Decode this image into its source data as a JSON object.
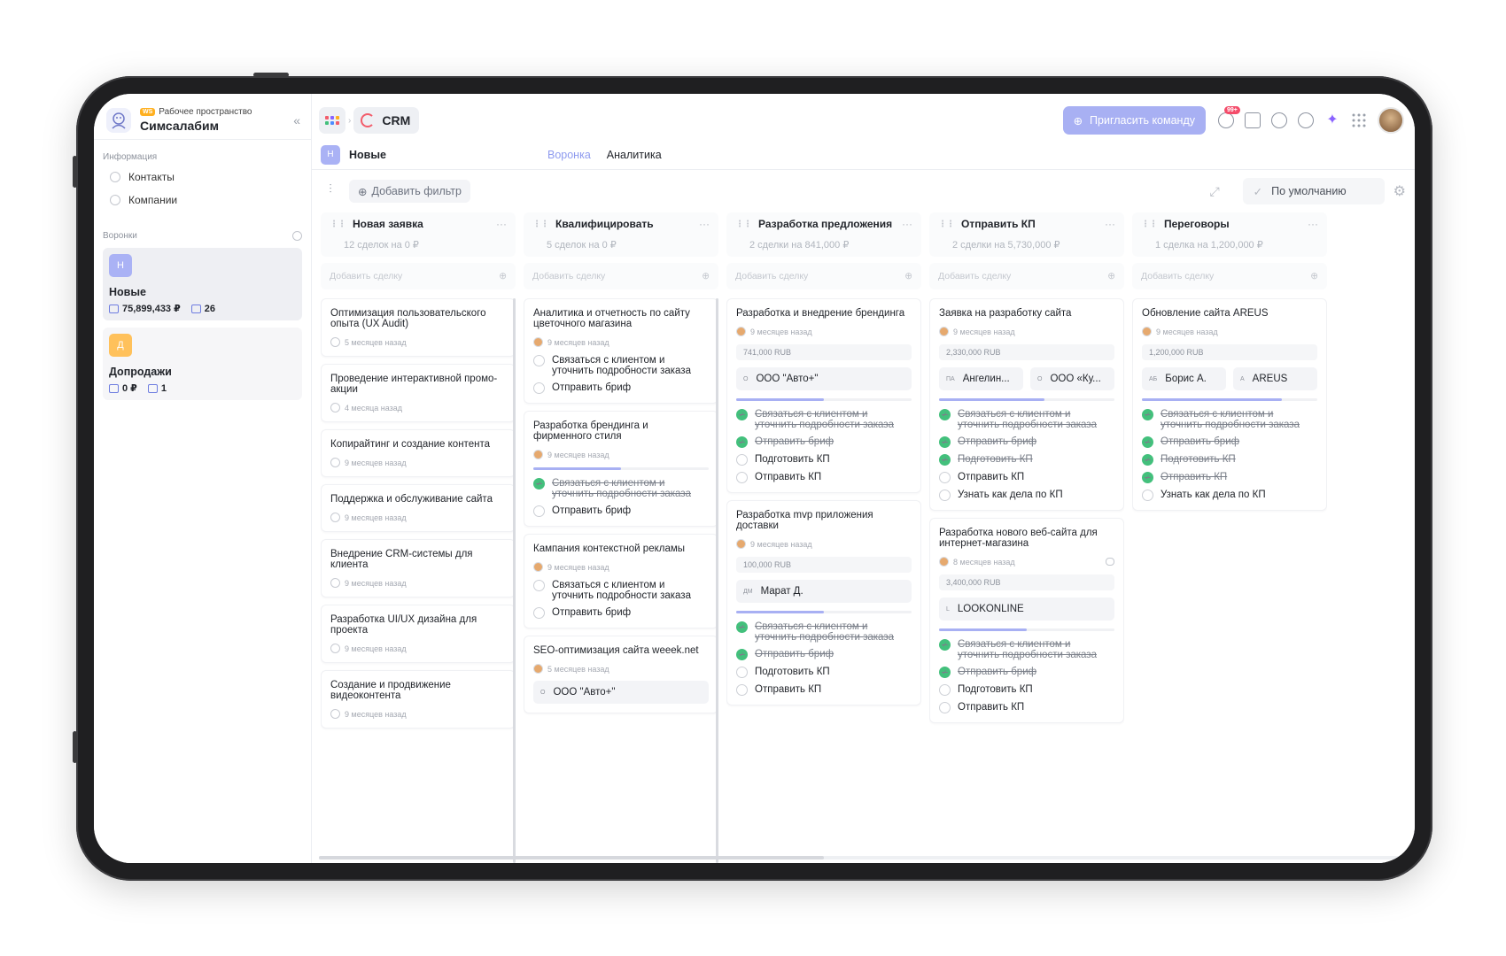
{
  "workspace": {
    "badge": "WS",
    "label": "Рабочее пространство",
    "name": "Симсалабим"
  },
  "sidebar": {
    "info_title": "Информация",
    "info_items": [
      {
        "label": "Контакты"
      },
      {
        "label": "Компании"
      }
    ],
    "funnels_title": "Воронки",
    "funnels": [
      {
        "letter": "Н",
        "name": "Новые",
        "amount": "75,899,433 ₽",
        "count": "26",
        "color": "#aab2f5"
      },
      {
        "letter": "Д",
        "name": "Допродажи",
        "amount": "0 ₽",
        "count": "1",
        "color": "#ffc15b"
      }
    ]
  },
  "topbar": {
    "crm_label": "CRM",
    "invite_label": "Пригласить команду",
    "bell_badge": "99+"
  },
  "subbar": {
    "letter": "Н",
    "title": "Новые",
    "tab_funnel": "Воронка",
    "tab_analytics": "Аналитика"
  },
  "filterbar": {
    "add_filter": "Добавить фильтр",
    "default_view": "По умолчанию"
  },
  "board": {
    "add_deal": "Добавить сделку",
    "columns": [
      {
        "title": "Новая заявка",
        "summary": "12 сделок на 0 ₽",
        "cards": [
          {
            "title": "Оптимизация пользовательского опыта (UX Audit)",
            "time": "5 месяцев назад"
          },
          {
            "title": "Проведение интерактивной промо-акции",
            "time": "4 месяца назад"
          },
          {
            "title": "Копирайтинг и создание контента",
            "time": "9 месяцев назад"
          },
          {
            "title": "Поддержка и обслуживание сайта",
            "time": "9 месяцев назад"
          },
          {
            "title": "Внедрение CRM-системы для клиента",
            "time": "9 месяцев назад"
          },
          {
            "title": "Разработка UI/UX дизайна для проекта",
            "time": "9 месяцев назад"
          },
          {
            "title": "Создание и продвижение видеоконтента",
            "time": "9 месяцев назад"
          }
        ]
      },
      {
        "title": "Квалифицировать",
        "summary": "5 сделок на 0 ₽",
        "cards": [
          {
            "title": "Аналитика и отчетность по сайту цветочного магазина",
            "time": "9 месяцев назад",
            "tasks": [
              {
                "t": "Связаться с клиентом и уточнить подробности заказа",
                "done": false
              },
              {
                "t": "Отправить бриф",
                "done": false
              }
            ]
          },
          {
            "title": "Разработка брендинга и фирменного стиля",
            "time": "9 месяцев назад",
            "progress": 0.5,
            "tasks": [
              {
                "t": "Связаться с клиентом и уточнить подробности заказа",
                "done": true
              },
              {
                "t": "Отправить бриф",
                "done": false
              }
            ]
          },
          {
            "title": "Кампания контекстной рекламы",
            "time": "9 месяцев назад",
            "tasks": [
              {
                "t": "Связаться с клиентом и уточнить подробности заказа",
                "done": false
              },
              {
                "t": "Отправить бриф",
                "done": false
              }
            ]
          },
          {
            "title": "SEO-оптимизация сайта weeek.net",
            "time": "5 месяцев назад",
            "chips": [
              {
                "ini": "О",
                "label": "ООО \"Авто+\""
              }
            ]
          }
        ]
      },
      {
        "title": "Разработка предложения",
        "summary": "2 сделки на 841,000 ₽",
        "cards": [
          {
            "title": "Разработка и внедрение брендинга",
            "time": "9 месяцев назад",
            "amount": "741,000 RUB",
            "chips": [
              {
                "ini": "О",
                "label": "ООО \"Авто+\""
              }
            ],
            "progress": 0.5,
            "tasks": [
              {
                "t": "Связаться с клиентом и уточнить подробности заказа",
                "done": true
              },
              {
                "t": "Отправить бриф",
                "done": true
              },
              {
                "t": "Подготовить КП",
                "done": false
              },
              {
                "t": "Отправить КП",
                "done": false
              }
            ]
          },
          {
            "title": "Разработка mvp приложения доставки",
            "time": "9 месяцев назад",
            "amount": "100,000 RUB",
            "chips": [
              {
                "ini": "ДМ",
                "label": "Марат Д."
              }
            ],
            "progress": 0.5,
            "tasks": [
              {
                "t": "Связаться с клиентом и уточнить подробности заказа",
                "done": true
              },
              {
                "t": "Отправить бриф",
                "done": true
              },
              {
                "t": "Подготовить КП",
                "done": false
              },
              {
                "t": "Отправить КП",
                "done": false
              }
            ]
          }
        ]
      },
      {
        "title": "Отправить КП",
        "summary": "2 сделки на 5,730,000 ₽",
        "cards": [
          {
            "title": "Заявка на разработку сайта",
            "time": "9 месяцев назад",
            "amount": "2,330,000 RUB",
            "chips": [
              {
                "ini": "ПА",
                "label": "Ангелин..."
              },
              {
                "ini": "О",
                "label": "ООО «Ку..."
              }
            ],
            "progress": 0.6,
            "tasks": [
              {
                "t": "Связаться с клиентом и уточнить подробности заказа",
                "done": true
              },
              {
                "t": "Отправить бриф",
                "done": true
              },
              {
                "t": "Подготовить КП",
                "done": true
              },
              {
                "t": "Отправить КП",
                "done": false
              },
              {
                "t": "Узнать как дела по КП",
                "done": false
              }
            ]
          },
          {
            "title": "Разработка нового веб-сайта для интернет-магазина",
            "time": "8 месяцев назад",
            "amount": "3,400,000 RUB",
            "comment": true,
            "chips": [
              {
                "ini": "L",
                "label": "LOOKONLINE"
              }
            ],
            "progress": 0.5,
            "tasks": [
              {
                "t": "Связаться с клиентом и уточнить подробности заказа",
                "done": true
              },
              {
                "t": "Отправить бриф",
                "done": true
              },
              {
                "t": "Подготовить КП",
                "done": false
              },
              {
                "t": "Отправить КП",
                "done": false
              }
            ]
          }
        ]
      },
      {
        "title": "Переговоры",
        "summary": "1 сделка на 1,200,000 ₽",
        "cards": [
          {
            "title": "Обновление сайта AREUS",
            "time": "9 месяцев назад",
            "amount": "1,200,000 RUB",
            "chips": [
              {
                "ini": "АБ",
                "label": "Борис А."
              },
              {
                "ini": "A",
                "label": "AREUS"
              }
            ],
            "progress": 0.8,
            "tasks": [
              {
                "t": "Связаться с клиентом и уточнить подробности заказа",
                "done": true
              },
              {
                "t": "Отправить бриф",
                "done": true
              },
              {
                "t": "Подготовить КП",
                "done": true
              },
              {
                "t": "Отправить КП",
                "done": true
              },
              {
                "t": "Узнать как дела по КП",
                "done": false
              }
            ]
          }
        ]
      }
    ]
  },
  "colors": {
    "accent": "#a8b0f3",
    "done": "#43c07c",
    "crm_icon": "#f25d6b"
  }
}
